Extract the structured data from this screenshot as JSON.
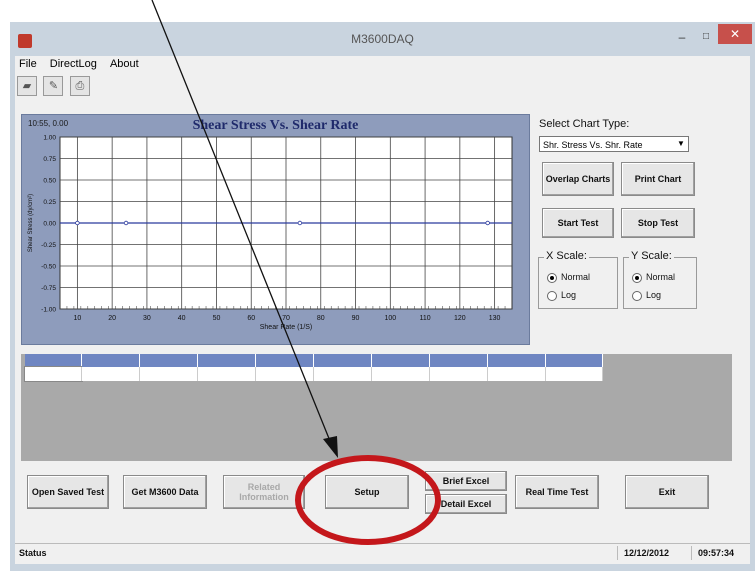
{
  "window": {
    "title": "M3600DAQ",
    "minimize": "–",
    "maximize": "□",
    "close": "✕"
  },
  "menu": [
    "File",
    "DirectLog",
    "About"
  ],
  "toolbar": {
    "icons": [
      "open-folder-icon",
      "save-icon",
      "print-icon"
    ]
  },
  "chart": {
    "timestamp": "10:55, 0.00",
    "title": "Shear Stress Vs. Shear Rate",
    "ytick_labels": [
      "1.00",
      "0.75",
      "0.50",
      "0.25",
      "0.00",
      "-0.25",
      "-0.50",
      "-0.75",
      "-1.00"
    ],
    "xtick_labels": [
      "10",
      "20",
      "30",
      "40",
      "50",
      "60",
      "70",
      "80",
      "90",
      "100",
      "110",
      "120",
      "130"
    ],
    "xlabel": "Shear Rate (1/S)",
    "ylabel": "Shear Stress (dy/cm²)"
  },
  "chart_data": {
    "type": "line",
    "title": "Shear Stress Vs. Shear Rate",
    "xlabel": "Shear Rate (1/S)",
    "ylabel": "Shear Stress (dy/cm²)",
    "xlim": [
      5,
      135
    ],
    "ylim": [
      -1.0,
      1.0
    ],
    "grid": true,
    "series": [
      {
        "values": [
          {
            "x": 5,
            "y": 0
          },
          {
            "x": 10,
            "y": 0
          },
          {
            "x": 24,
            "y": 0
          },
          {
            "x": 74,
            "y": 0
          },
          {
            "x": 128,
            "y": 0
          },
          {
            "x": 135,
            "y": 0
          }
        ],
        "color": "#2b3a9e"
      }
    ]
  },
  "right_panel": {
    "select_chart_label": "Select Chart Type:",
    "chart_type_value": "Shr. Stress Vs. Shr. Rate",
    "overlap_charts": "Overlap Charts",
    "print_chart": "Print Chart",
    "start_test": "Start Test",
    "stop_test": "Stop Test",
    "x_scale": {
      "title": "X Scale:",
      "normal": "Normal",
      "log": "Log",
      "selected": "Normal"
    },
    "y_scale": {
      "title": "Y Scale:",
      "normal": "Normal",
      "log": "Log",
      "selected": "Normal"
    }
  },
  "bottom_buttons": {
    "open_saved": "Open Saved Test",
    "get_m3600": "Get M3600 Data",
    "related_info": "Related Information",
    "setup": "Setup",
    "brief_excel": "Brief Excel",
    "detail_excel": "Detail Excel",
    "real_time": "Real Time Test",
    "exit": "Exit"
  },
  "statusbar": {
    "status": "Status",
    "date": "12/12/2012",
    "time": "09:57:34"
  },
  "colors": {
    "chart_bg": "#8e9cbc",
    "grid_header": "#6f86c2",
    "highlight": "#c4171b",
    "series": "#2b3a9e"
  }
}
